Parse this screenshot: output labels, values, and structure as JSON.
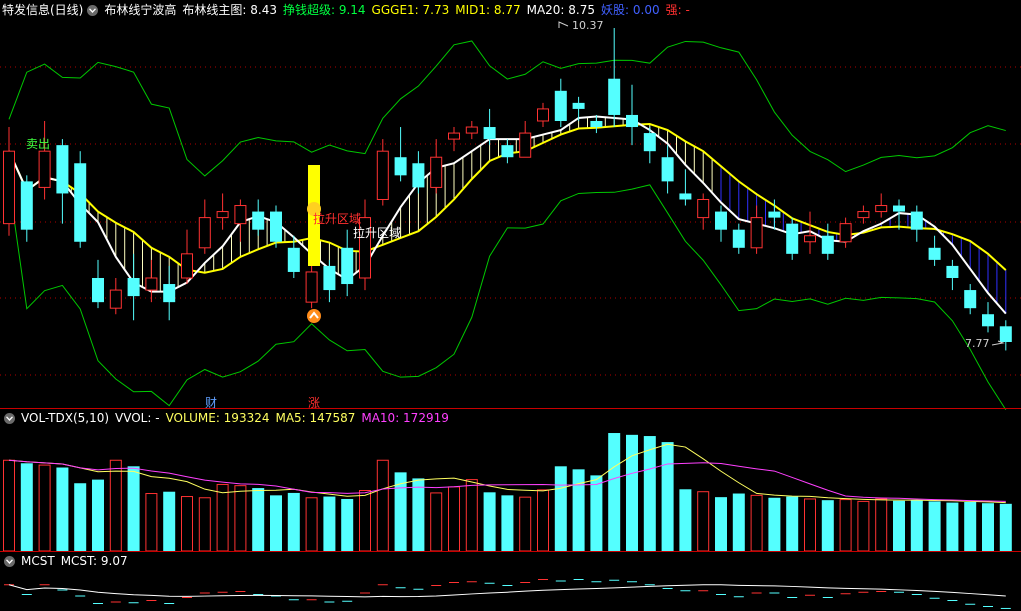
{
  "header": {
    "stock_name": "特发信息(日线)",
    "indicator_name": "布林线宁波高",
    "items": [
      {
        "label": "布林线主图:",
        "value": "8.43",
        "color": "#ffffff"
      },
      {
        "label": "挣钱超级:",
        "value": "9.14",
        "color": "#00ff40"
      },
      {
        "label": "GGGE1:",
        "value": "7.73",
        "color": "#ffff00"
      },
      {
        "label": "MID1:",
        "value": "8.77",
        "color": "#ffff00"
      },
      {
        "label": "MA20:",
        "value": "8.75",
        "color": "#ffffff"
      },
      {
        "label": "妖股:",
        "value": "0.00",
        "color": "#4060ff"
      },
      {
        "label": "强:",
        "value": "-",
        "color": "#ff3030"
      }
    ]
  },
  "annotations": {
    "high_price": "10.37",
    "low_price": "7.77",
    "sell_label": "卖出",
    "zone_label_red": "拉升区域",
    "zone_label_white": "拉升区域",
    "marker_cai": "财",
    "marker_zhang": "涨"
  },
  "volume_header": {
    "name": "VOL-TDX(5,10)",
    "items": [
      {
        "label": "VVOL:",
        "value": "-",
        "color": "#ffffff"
      },
      {
        "label": "VOLUME:",
        "value": "193324",
        "color": "#ffff60"
      },
      {
        "label": "MA5:",
        "value": "147587",
        "color": "#ffff60"
      },
      {
        "label": "MA10:",
        "value": "172919",
        "color": "#ff40ff"
      }
    ]
  },
  "mcst_header": {
    "name": "MCST",
    "items": [
      {
        "label": "MCST:",
        "value": "9.07",
        "color": "#ffffff"
      }
    ]
  },
  "colors": {
    "up": "#ff3232",
    "down": "#54ffff",
    "band": "#00c800",
    "ma": "#ffff00",
    "separator": "#c80000",
    "magenta": "#ff40ff"
  },
  "chart_data": {
    "type": "candlestick",
    "price_range": [
      7.77,
      10.37
    ],
    "candles_open_close_high_low": [
      [
        8.75,
        9.35,
        9.55,
        8.65
      ],
      [
        9.1,
        8.7,
        9.15,
        8.6
      ],
      [
        9.05,
        9.35,
        9.6,
        8.95
      ],
      [
        9.4,
        9.0,
        9.45,
        8.75
      ],
      [
        9.25,
        8.6,
        9.35,
        8.55
      ],
      [
        8.3,
        8.1,
        8.45,
        8.05
      ],
      [
        8.05,
        8.2,
        8.3,
        8.0
      ],
      [
        8.3,
        8.15,
        8.5,
        7.95
      ],
      [
        8.2,
        8.3,
        8.45,
        8.1
      ],
      [
        8.25,
        8.1,
        8.4,
        7.95
      ],
      [
        8.3,
        8.5,
        8.7,
        8.25
      ],
      [
        8.55,
        8.8,
        8.95,
        8.5
      ],
      [
        8.8,
        8.85,
        9.0,
        8.7
      ],
      [
        8.75,
        8.9,
        8.95,
        8.6
      ],
      [
        8.85,
        8.7,
        8.95,
        8.65
      ],
      [
        8.85,
        8.6,
        8.9,
        8.55
      ],
      [
        8.55,
        8.35,
        8.65,
        8.3
      ],
      [
        8.1,
        8.35,
        8.4,
        8.05
      ],
      [
        8.4,
        8.2,
        8.45,
        8.1
      ],
      [
        8.55,
        8.25,
        8.7,
        8.15
      ],
      [
        8.3,
        8.8,
        8.95,
        8.2
      ],
      [
        8.95,
        9.35,
        9.45,
        8.9
      ],
      [
        9.3,
        9.15,
        9.55,
        9.1
      ],
      [
        9.25,
        9.05,
        9.35,
        9.0
      ],
      [
        9.05,
        9.3,
        9.45,
        9.0
      ],
      [
        9.45,
        9.5,
        9.55,
        9.35
      ],
      [
        9.5,
        9.55,
        9.6,
        9.45
      ],
      [
        9.55,
        9.45,
        9.7,
        9.4
      ],
      [
        9.4,
        9.3,
        9.45,
        9.25
      ],
      [
        9.3,
        9.5,
        9.6,
        9.3
      ],
      [
        9.6,
        9.7,
        9.75,
        9.55
      ],
      [
        9.85,
        9.6,
        9.95,
        9.55
      ],
      [
        9.75,
        9.7,
        9.8,
        9.6
      ],
      [
        9.6,
        9.55,
        9.65,
        9.5
      ],
      [
        9.95,
        9.65,
        10.37,
        9.55
      ],
      [
        9.65,
        9.55,
        9.9,
        9.4
      ],
      [
        9.5,
        9.35,
        9.55,
        9.25
      ],
      [
        9.3,
        9.1,
        9.4,
        9.0
      ],
      [
        9.0,
        8.95,
        9.2,
        8.9
      ],
      [
        8.8,
        8.95,
        9.0,
        8.7
      ],
      [
        8.85,
        8.7,
        8.9,
        8.6
      ],
      [
        8.7,
        8.55,
        8.75,
        8.5
      ],
      [
        8.55,
        8.8,
        8.9,
        8.5
      ],
      [
        8.85,
        8.8,
        8.95,
        8.7
      ],
      [
        8.75,
        8.5,
        8.8,
        8.45
      ],
      [
        8.6,
        8.65,
        8.85,
        8.5
      ],
      [
        8.65,
        8.5,
        8.75,
        8.45
      ],
      [
        8.6,
        8.75,
        8.8,
        8.55
      ],
      [
        8.8,
        8.85,
        8.9,
        8.75
      ],
      [
        8.85,
        8.9,
        9.0,
        8.8
      ],
      [
        8.9,
        8.85,
        8.95,
        8.7
      ],
      [
        8.85,
        8.7,
        8.9,
        8.6
      ],
      [
        8.55,
        8.45,
        8.65,
        8.4
      ],
      [
        8.4,
        8.3,
        8.45,
        8.2
      ],
      [
        8.2,
        8.05,
        8.25,
        8.0
      ],
      [
        8.0,
        7.9,
        8.1,
        7.85
      ],
      [
        7.9,
        7.77,
        7.95,
        7.7
      ]
    ],
    "volume": [
      150000,
      145000,
      142000,
      138000,
      112000,
      118000,
      150000,
      140000,
      95000,
      98000,
      90000,
      88000,
      110000,
      108000,
      104000,
      92000,
      96000,
      88000,
      90000,
      86000,
      100000,
      150000,
      130000,
      120000,
      96000,
      106000,
      118000,
      97000,
      92000,
      89000,
      101000,
      140000,
      135000,
      125000,
      195000,
      192000,
      190000,
      180000,
      102000,
      98000,
      89000,
      95000,
      92000,
      88000,
      90000,
      86000,
      84000,
      85000,
      82000,
      86000,
      83000,
      84000,
      82000,
      80000,
      81000,
      79000,
      78000
    ],
    "mcst_last": 9.07
  }
}
